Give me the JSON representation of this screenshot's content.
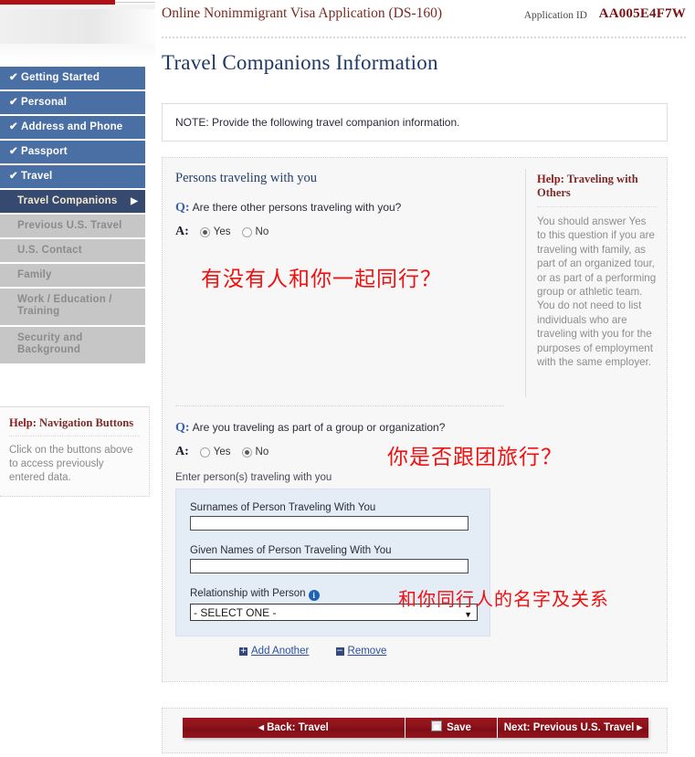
{
  "header": {
    "title": "Online Nonimmigrant Visa Application (DS-160)",
    "app_id_label": "Application ID",
    "app_id_value": "AA005E4F7W"
  },
  "page_title": "Travel Companions Information",
  "note": "NOTE: Provide the following travel companion information.",
  "sidebar": {
    "items": [
      {
        "label": "Getting Started",
        "state": "done"
      },
      {
        "label": "Personal",
        "state": "done"
      },
      {
        "label": "Address and Phone",
        "state": "done"
      },
      {
        "label": "Passport",
        "state": "done"
      },
      {
        "label": "Travel",
        "state": "done"
      },
      {
        "label": "Travel Companions",
        "state": "current"
      },
      {
        "label": "Previous U.S. Travel",
        "state": "pending"
      },
      {
        "label": "U.S. Contact",
        "state": "pending"
      },
      {
        "label": "Family",
        "state": "pending"
      },
      {
        "label": "Work / Education / Training",
        "state": "pending"
      },
      {
        "label": "Security and Background",
        "state": "pending"
      }
    ],
    "check_glyph": "✔",
    "arrow_glyph": "▶",
    "help": {
      "title_prefix": "Help:",
      "title_rest": " Navigation Buttons",
      "body": "Click on the buttons above to access previously entered data."
    }
  },
  "panel": {
    "section_heading": "Persons traveling with you",
    "q_marker": "Q:",
    "a_marker": "A:",
    "question1": "Are there other persons traveling with you?",
    "question1_options": [
      {
        "label": "Yes",
        "selected": true
      },
      {
        "label": "No",
        "selected": false
      }
    ],
    "question2": "Are you traveling as part of a group or organization?",
    "question2_options": [
      {
        "label": "Yes",
        "selected": false
      },
      {
        "label": "No",
        "selected": true
      }
    ],
    "enter_persons_label": "Enter person(s) traveling with you",
    "fields": {
      "surname_label": "Surnames of Person Traveling With You",
      "surname_value": "",
      "given_label": "Given Names of Person Traveling With You",
      "given_value": "",
      "relationship_label": "Relationship with Person",
      "relationship_value": "- SELECT ONE -",
      "relationship_options": [
        "- SELECT ONE -"
      ],
      "info_glyph": "i",
      "caret_glyph": "▼"
    },
    "add_another": "Add Another",
    "remove": "Remove",
    "plus_glyph": "+",
    "minus_glyph": "−",
    "help": {
      "title_prefix": "Help:",
      "title_rest": " Traveling with Others",
      "body": "You should answer Yes to this question if you are traveling with family, as part of an organized tour, or as part of a performing group or athletic team. You do not need to list individuals who are traveling with you for the purposes of employment with the same employer."
    }
  },
  "annotations": {
    "note_q1": "有没有人和你一起同行？",
    "note_q2": "你是否跟团旅行？",
    "note_fields": "和你同行人的名字及关系"
  },
  "buttons": {
    "back": "◂ Back: Travel",
    "save": "Save",
    "next": "Next: Previous U.S. Travel ▸"
  },
  "colors": {
    "accent_red": "#b01116",
    "nav_done": "#4a6fa5",
    "nav_current": "#36496e",
    "nav_pending": "#c6c6c6",
    "annotation_red": "#f01010",
    "title_blue": "#1f3864"
  }
}
